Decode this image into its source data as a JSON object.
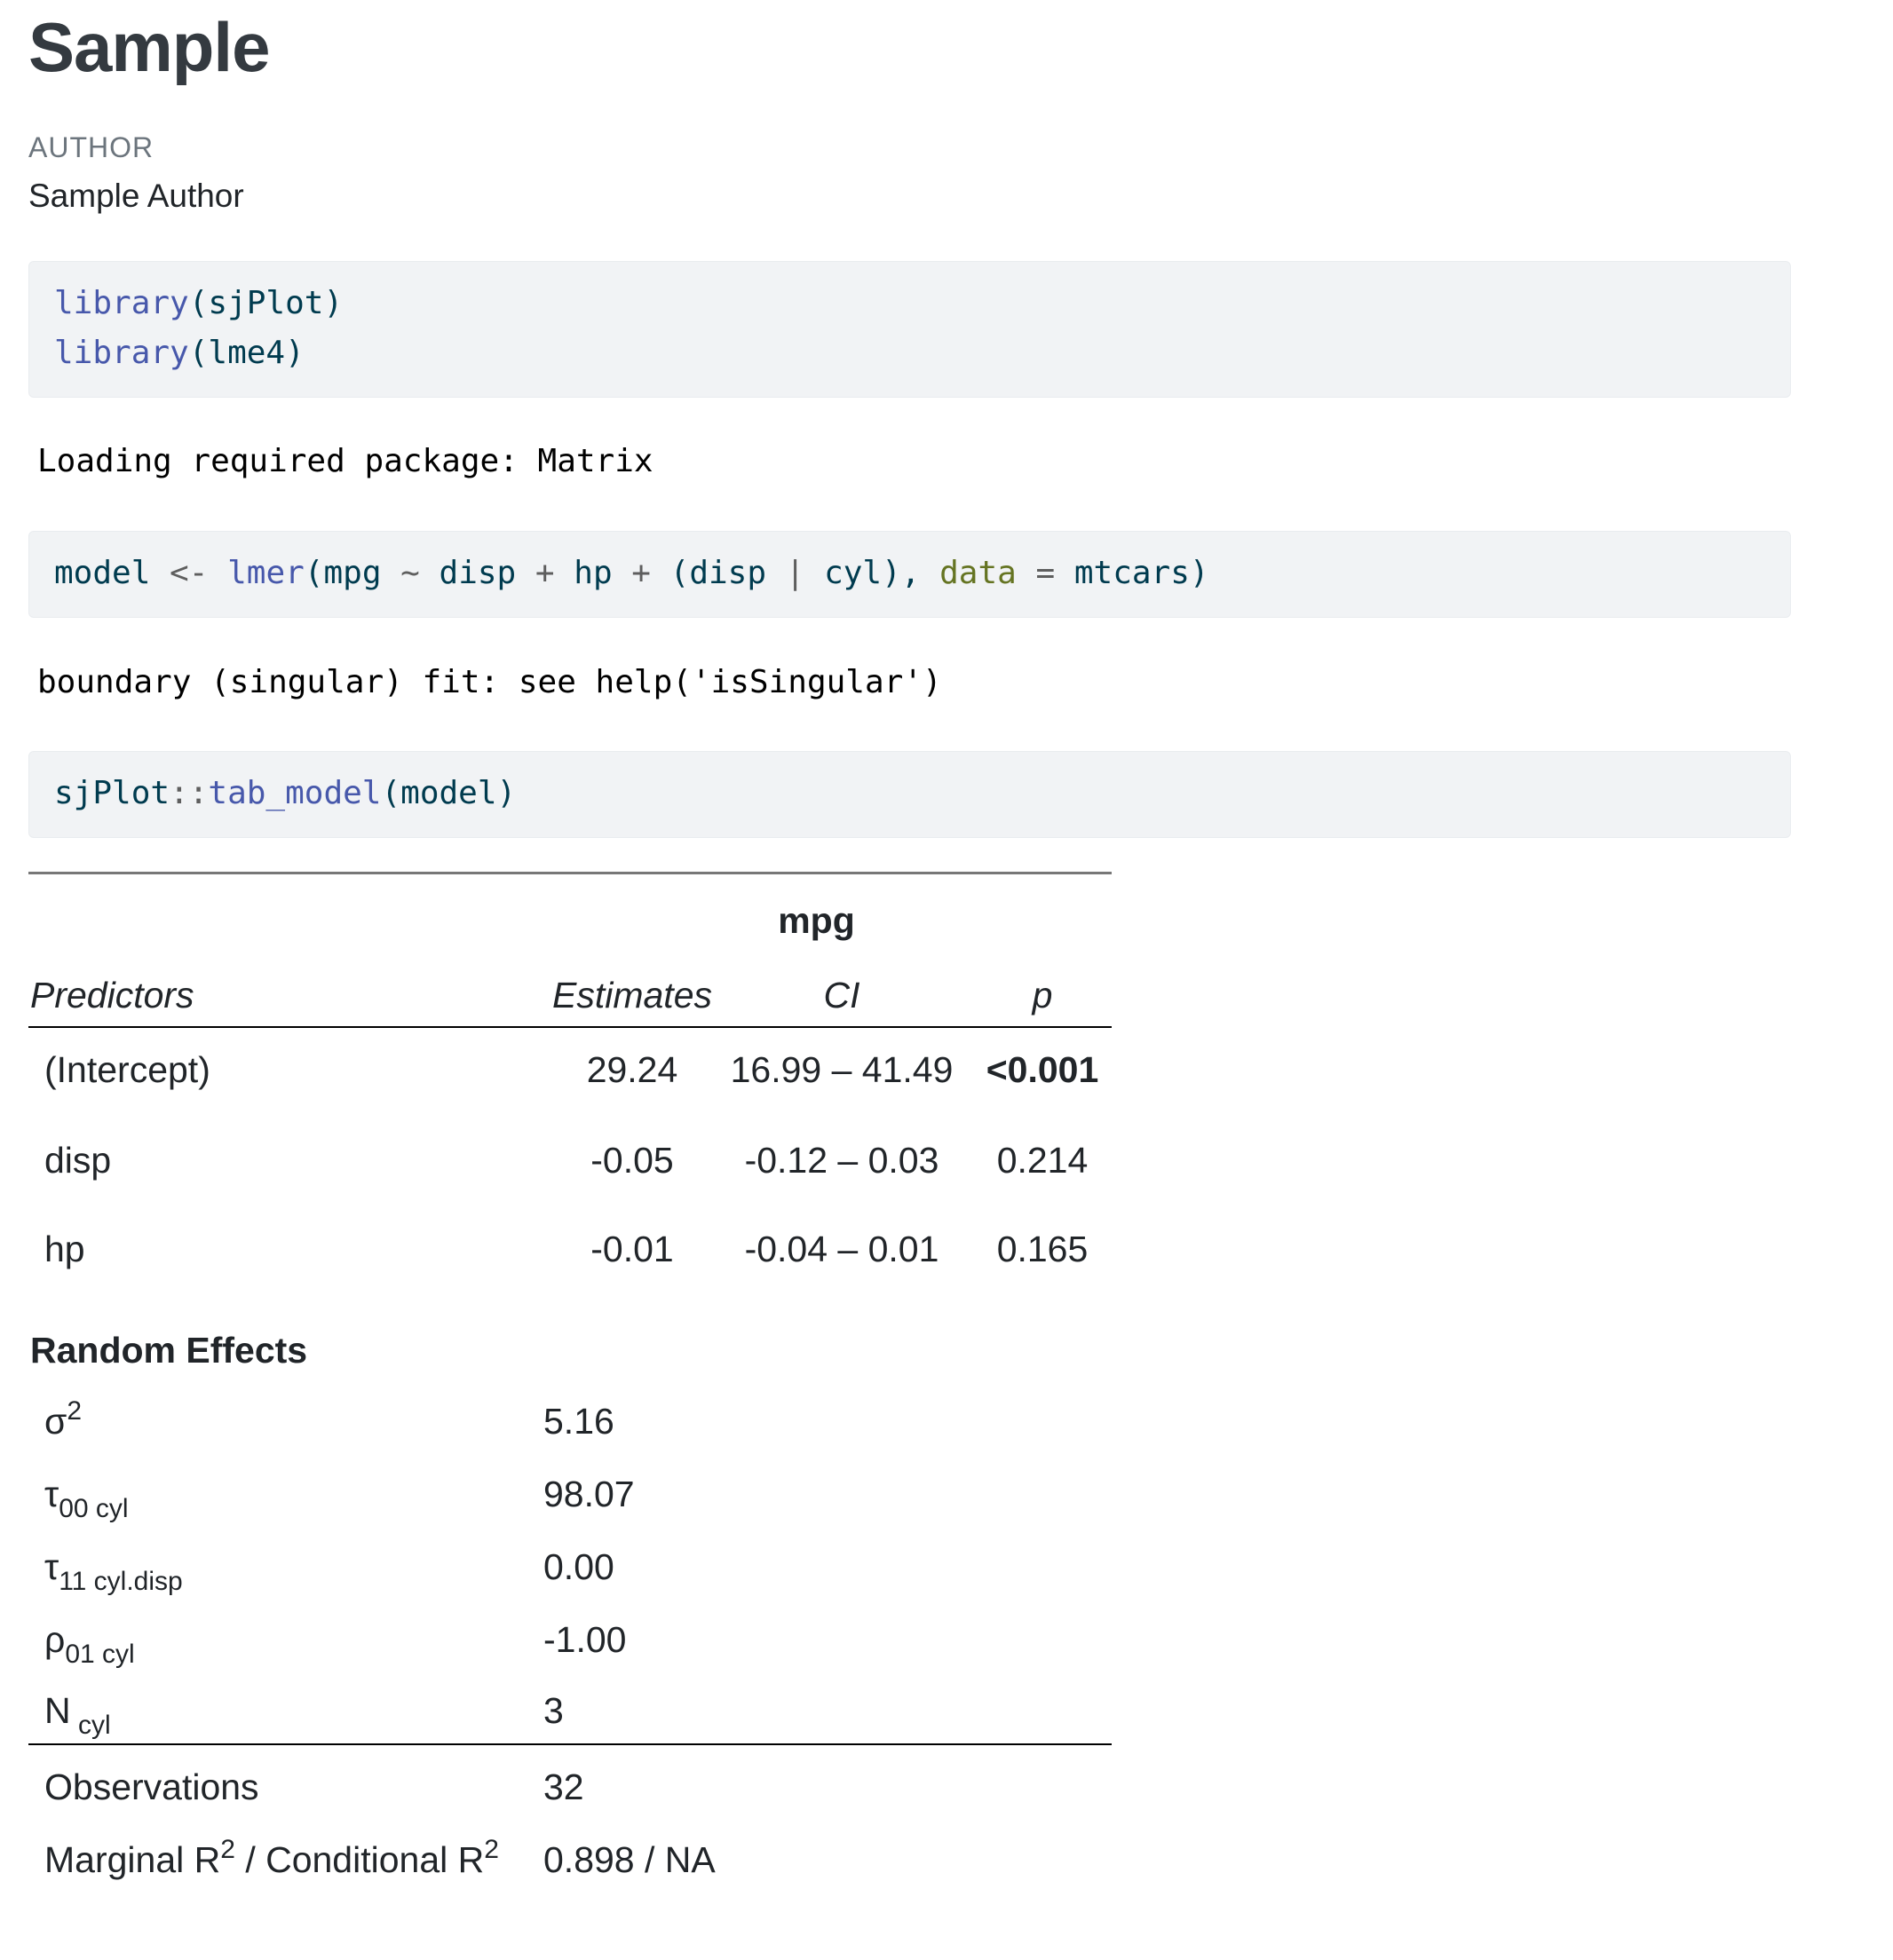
{
  "title": "Sample",
  "author_label": "AUTHOR",
  "author_name": "Sample Author",
  "code_blocks": [
    {
      "lines": [
        {
          "fn": "library",
          "open": "(",
          "arg": "sjPlot",
          "close": ")"
        },
        {
          "fn": "library",
          "open": "(",
          "arg": "lme4",
          "close": ")"
        }
      ]
    },
    {
      "tokens": {
        "t1": "model ",
        "t2": "<-",
        "t3": " ",
        "t4": "lmer",
        "t5": "(mpg ",
        "t6": "~",
        "t7": " disp ",
        "t8": "+",
        "t9": " hp ",
        "t10": "+",
        "t11": " (disp ",
        "t12": "|",
        "t13": " cyl), ",
        "t14": "data",
        "t15": " ",
        "t16": "=",
        "t17": " mtcars)"
      }
    },
    {
      "tokens": {
        "t1": "sjPlot",
        "t2": "::",
        "t3": "tab_model",
        "t4": "(model)"
      }
    }
  ],
  "outputs": [
    "Loading required package: Matrix",
    "boundary (singular) fit: see help('isSingular')"
  ],
  "table": {
    "dependent": "mpg",
    "headers": {
      "predictors": "Predictors",
      "estimates": "Estimates",
      "ci": "CI",
      "p": "p"
    },
    "rows": [
      {
        "predictor": "(Intercept)",
        "estimate": "29.24",
        "ci": "16.99 – 41.49",
        "p": "<0.001"
      },
      {
        "predictor": "disp",
        "estimate": "-0.05",
        "ci": "-0.12 – 0.03",
        "p": "0.214"
      },
      {
        "predictor": "hp",
        "estimate": "-0.01",
        "ci": "-0.04 – 0.01",
        "p": "0.165"
      }
    ],
    "random_effects": {
      "heading": "Random Effects",
      "rows": [
        {
          "symbol": "σ",
          "sup": "2",
          "sub": "",
          "value": "5.16"
        },
        {
          "symbol": "τ",
          "sup": "",
          "sub": "00 cyl",
          "value": "98.07"
        },
        {
          "symbol": "τ",
          "sup": "",
          "sub": "11 cyl.disp",
          "value": "0.00"
        },
        {
          "symbol": "ρ",
          "sup": "",
          "sub": "01 cyl",
          "value": "-1.00"
        },
        {
          "symbol": "N",
          "sup": "",
          "sub": " cyl",
          "value": "3"
        }
      ]
    },
    "observations": {
      "label": "Observations",
      "value": "32"
    },
    "r2": {
      "label_a": "Marginal R",
      "sup_a": "2",
      "label_b": " / Conditional R",
      "sup_b": "2",
      "value": "0.898 / NA"
    }
  }
}
